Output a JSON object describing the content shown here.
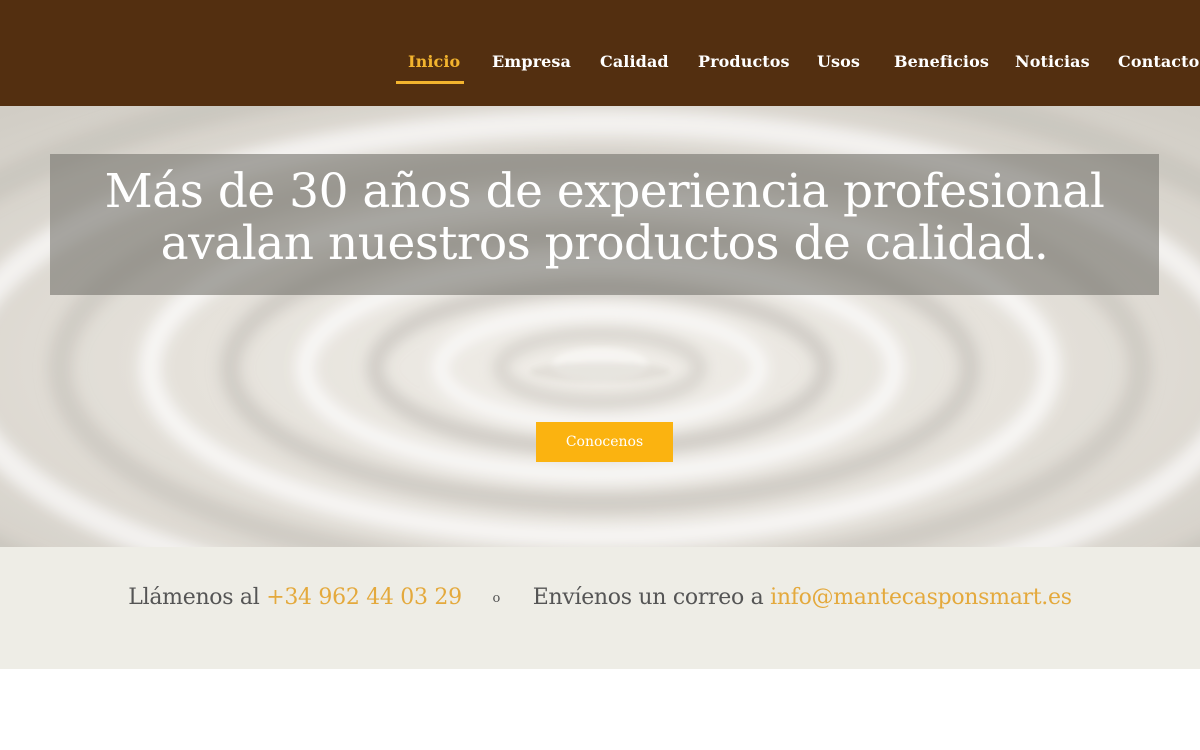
{
  "nav": {
    "items": [
      {
        "label": "Inicio",
        "active": true
      },
      {
        "label": "Empresa",
        "active": false
      },
      {
        "label": "Calidad",
        "active": false
      },
      {
        "label": "Productos",
        "active": false
      },
      {
        "label": "Usos",
        "active": false
      },
      {
        "label": "Beneficios",
        "active": false
      },
      {
        "label": "Noticias",
        "active": false
      },
      {
        "label": "Contacto",
        "active": false
      }
    ]
  },
  "hero": {
    "headline_line1": "Más de 30 años de experiencia profesional",
    "headline_line2": "avalan nuestros productos de calidad.",
    "cta_label": "Conocenos"
  },
  "contact": {
    "call_prefix": "Llámenos al",
    "phone": "+34 962 44 03 29",
    "separator": "o",
    "email_prefix": "Envíenos un correo a",
    "email": "info@mantecasponsmart.es"
  },
  "colors": {
    "header_bg": "#532f10",
    "accent": "#f3b42e",
    "cta_bg": "#fbb310",
    "contact_band_bg": "#eeede6",
    "link": "#e4a93c"
  }
}
